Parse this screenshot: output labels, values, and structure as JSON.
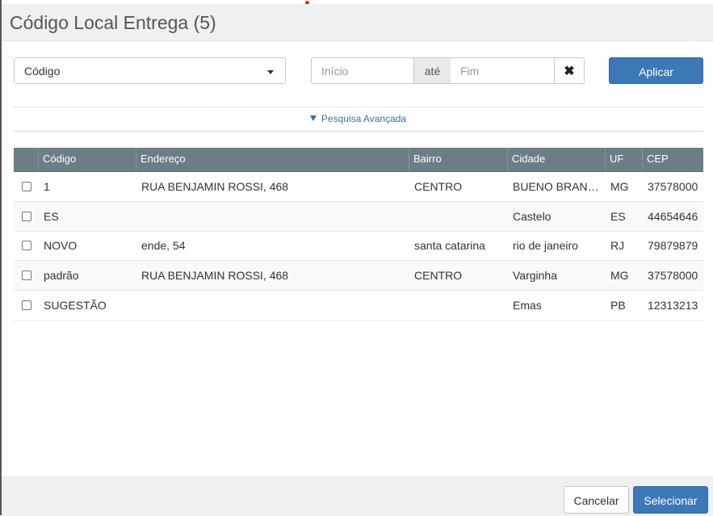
{
  "header": {
    "title": "Código Local Entrega (5)"
  },
  "filter": {
    "field_select": {
      "value": "Código"
    },
    "range": {
      "start_placeholder": "Início",
      "between_label": "até",
      "end_placeholder": "Fim"
    },
    "clear_icon": "✖",
    "apply_label": "Aplicar",
    "advanced_label": "Pesquisa Avançada"
  },
  "table": {
    "columns": [
      "Código",
      "Endereço",
      "Bairro",
      "Cidade",
      "UF",
      "CEP"
    ],
    "rows": [
      {
        "codigo": "1",
        "endereco": "RUA BENJAMIN ROSSI, 468",
        "bairro": "CENTRO",
        "cidade": "BUENO BRANDÃO",
        "uf": "MG",
        "cep": "37578000"
      },
      {
        "codigo": "ES",
        "endereco": "",
        "bairro": "",
        "cidade": "Castelo",
        "uf": "ES",
        "cep": "44654646"
      },
      {
        "codigo": "NOVO",
        "endereco": "ende, 54",
        "bairro": "santa catarina",
        "cidade": "rio de janeiro",
        "uf": "RJ",
        "cep": "79879879"
      },
      {
        "codigo": "padrão",
        "endereco": "RUA BENJAMIN ROSSI, 468",
        "bairro": "CENTRO",
        "cidade": "Varginha",
        "uf": "MG",
        "cep": "37578000"
      },
      {
        "codigo": "SUGESTÃO",
        "endereco": "",
        "bairro": "",
        "cidade": "Emas",
        "uf": "PB",
        "cep": "12313213"
      }
    ]
  },
  "footer": {
    "cancel_label": "Cancelar",
    "select_label": "Selecionar"
  },
  "colors": {
    "primary": "#3c78b5",
    "table_header": "#6d7d86",
    "link": "#3c6fa5"
  }
}
